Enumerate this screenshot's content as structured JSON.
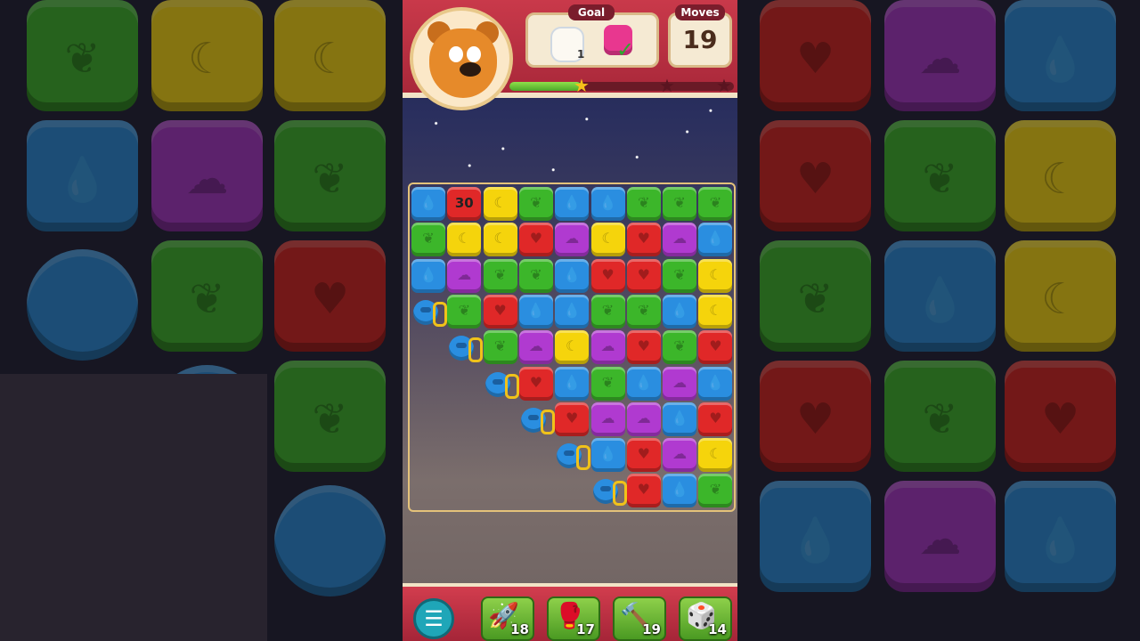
{
  "header": {
    "goal_label": "Goal",
    "moves_label": "Moves",
    "moves_value": "19",
    "goal_jar_count": "1",
    "goal_check": "✓",
    "score_progress": 0.32
  },
  "board": {
    "special_tile_text": "30"
  },
  "boosters": [
    {
      "name": "rocket",
      "count": "18",
      "icon": "🚀"
    },
    {
      "name": "boxing-glove",
      "count": "17",
      "icon": "🥊"
    },
    {
      "name": "hammer",
      "count": "19",
      "icon": "🔨"
    },
    {
      "name": "dice",
      "count": "14",
      "icon": "🎲"
    }
  ],
  "menu_icon": "☰",
  "colors": {
    "blue": "#2a8ee0",
    "red": "#e02828",
    "yellow": "#f5d40c",
    "green": "#3cb62a",
    "purple": "#b03ad0",
    "header": "#c9394a"
  }
}
